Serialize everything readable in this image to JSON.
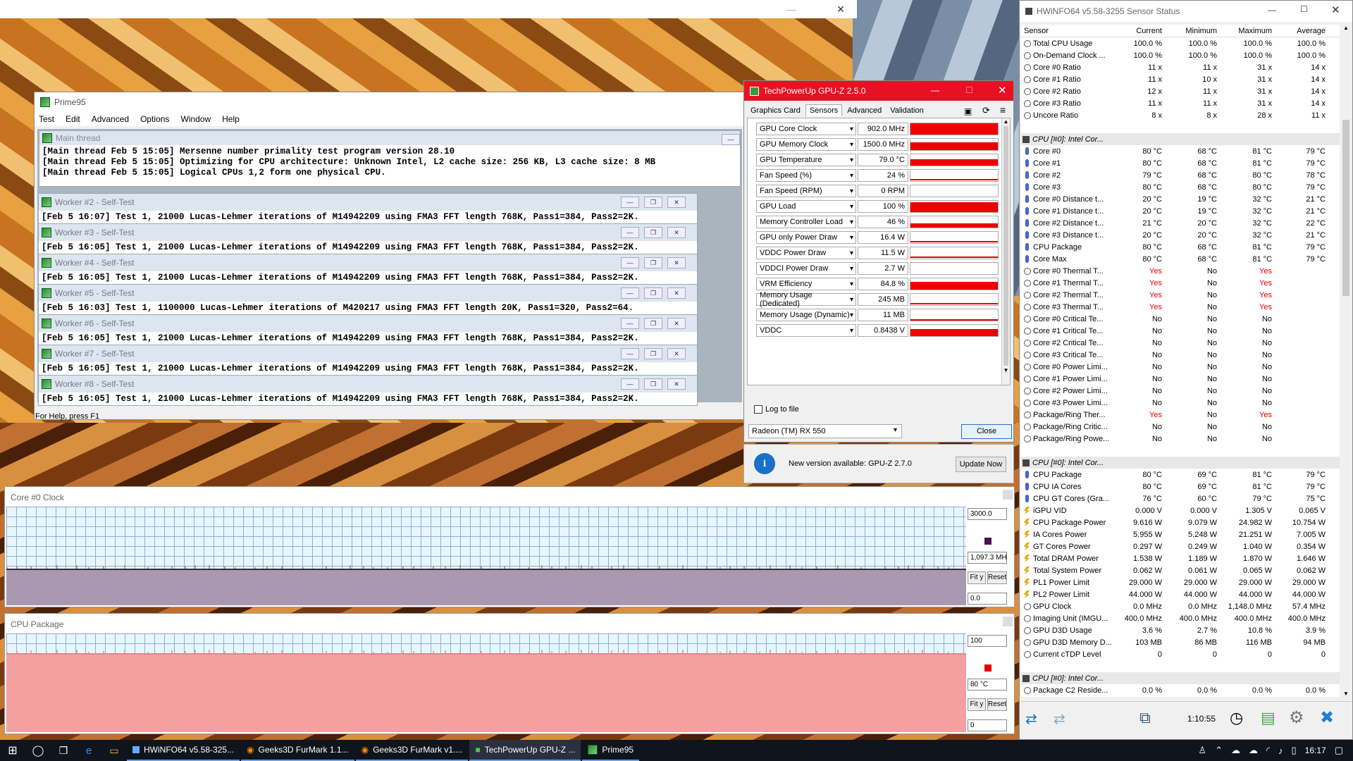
{
  "hwinfo": {
    "title": "HWiNFO64 v5.58-3255 Sensor Status",
    "columns": [
      "Sensor",
      "Current",
      "Minimum",
      "Maximum",
      "Average"
    ],
    "rows": [
      {
        "t": "row",
        "icon": "circle",
        "name": "Total CPU Usage",
        "cur": "100.0 %",
        "min": "100.0 %",
        "max": "100.0 %",
        "avg": "100.0 %"
      },
      {
        "t": "row",
        "icon": "circle",
        "name": "On-Demand Clock ...",
        "cur": "100.0 %",
        "min": "100.0 %",
        "max": "100.0 %",
        "avg": "100.0 %"
      },
      {
        "t": "row",
        "icon": "circle",
        "name": "Core #0 Ratio",
        "cur": "11 x",
        "min": "11 x",
        "max": "31 x",
        "avg": "14 x"
      },
      {
        "t": "row",
        "icon": "circle",
        "name": "Core #1 Ratio",
        "cur": "11 x",
        "min": "10 x",
        "max": "31 x",
        "avg": "14 x"
      },
      {
        "t": "row",
        "icon": "circle",
        "name": "Core #2 Ratio",
        "cur": "12 x",
        "min": "11 x",
        "max": "31 x",
        "avg": "14 x"
      },
      {
        "t": "row",
        "icon": "circle",
        "name": "Core #3 Ratio",
        "cur": "11 x",
        "min": "11 x",
        "max": "31 x",
        "avg": "14 x"
      },
      {
        "t": "row",
        "icon": "circle",
        "name": "Uncore Ratio",
        "cur": "8 x",
        "min": "8 x",
        "max": "28 x",
        "avg": "11 x"
      },
      {
        "t": "blank"
      },
      {
        "t": "group",
        "name": "CPU [#0]: Intel Cor..."
      },
      {
        "t": "row",
        "icon": "therm",
        "name": "Core #0",
        "cur": "80 °C",
        "min": "68 °C",
        "max": "81 °C",
        "avg": "79 °C"
      },
      {
        "t": "row",
        "icon": "therm",
        "name": "Core #1",
        "cur": "80 °C",
        "min": "68 °C",
        "max": "81 °C",
        "avg": "79 °C"
      },
      {
        "t": "row",
        "icon": "therm",
        "name": "Core #2",
        "cur": "79 °C",
        "min": "68 °C",
        "max": "80 °C",
        "avg": "78 °C"
      },
      {
        "t": "row",
        "icon": "therm",
        "name": "Core #3",
        "cur": "80 °C",
        "min": "68 °C",
        "max": "80 °C",
        "avg": "79 °C"
      },
      {
        "t": "row",
        "icon": "therm",
        "name": "Core #0 Distance t...",
        "cur": "20 °C",
        "min": "19 °C",
        "max": "32 °C",
        "avg": "21 °C"
      },
      {
        "t": "row",
        "icon": "therm",
        "name": "Core #1 Distance t...",
        "cur": "20 °C",
        "min": "19 °C",
        "max": "32 °C",
        "avg": "21 °C"
      },
      {
        "t": "row",
        "icon": "therm",
        "name": "Core #2 Distance t...",
        "cur": "21 °C",
        "min": "20 °C",
        "max": "32 °C",
        "avg": "22 °C"
      },
      {
        "t": "row",
        "icon": "therm",
        "name": "Core #3 Distance t...",
        "cur": "20 °C",
        "min": "20 °C",
        "max": "32 °C",
        "avg": "21 °C"
      },
      {
        "t": "row",
        "icon": "therm",
        "name": "CPU Package",
        "cur": "80 °C",
        "min": "68 °C",
        "max": "81 °C",
        "avg": "79 °C"
      },
      {
        "t": "row",
        "icon": "therm",
        "name": "Core Max",
        "cur": "80 °C",
        "min": "68 °C",
        "max": "81 °C",
        "avg": "79 °C"
      },
      {
        "t": "row",
        "icon": "circle",
        "name": "Core #0 Thermal T...",
        "cur": "Yes",
        "min": "No",
        "max": "Yes",
        "avg": "",
        "red": true
      },
      {
        "t": "row",
        "icon": "circle",
        "name": "Core #1 Thermal T...",
        "cur": "Yes",
        "min": "No",
        "max": "Yes",
        "avg": "",
        "red": true
      },
      {
        "t": "row",
        "icon": "circle",
        "name": "Core #2 Thermal T...",
        "cur": "Yes",
        "min": "No",
        "max": "Yes",
        "avg": "",
        "red": true
      },
      {
        "t": "row",
        "icon": "circle",
        "name": "Core #3 Thermal T...",
        "cur": "Yes",
        "min": "No",
        "max": "Yes",
        "avg": "",
        "red": true
      },
      {
        "t": "row",
        "icon": "circle",
        "name": "Core #0 Critical Te...",
        "cur": "No",
        "min": "No",
        "max": "No",
        "avg": ""
      },
      {
        "t": "row",
        "icon": "circle",
        "name": "Core #1 Critical Te...",
        "cur": "No",
        "min": "No",
        "max": "No",
        "avg": ""
      },
      {
        "t": "row",
        "icon": "circle",
        "name": "Core #2 Critical Te...",
        "cur": "No",
        "min": "No",
        "max": "No",
        "avg": ""
      },
      {
        "t": "row",
        "icon": "circle",
        "name": "Core #3 Critical Te...",
        "cur": "No",
        "min": "No",
        "max": "No",
        "avg": ""
      },
      {
        "t": "row",
        "icon": "circle",
        "name": "Core #0 Power Limi...",
        "cur": "No",
        "min": "No",
        "max": "No",
        "avg": ""
      },
      {
        "t": "row",
        "icon": "circle",
        "name": "Core #1 Power Limi...",
        "cur": "No",
        "min": "No",
        "max": "No",
        "avg": ""
      },
      {
        "t": "row",
        "icon": "circle",
        "name": "Core #2 Power Limi...",
        "cur": "No",
        "min": "No",
        "max": "No",
        "avg": ""
      },
      {
        "t": "row",
        "icon": "circle",
        "name": "Core #3 Power Limi...",
        "cur": "No",
        "min": "No",
        "max": "No",
        "avg": ""
      },
      {
        "t": "row",
        "icon": "circle",
        "name": "Package/Ring Ther...",
        "cur": "Yes",
        "min": "No",
        "max": "Yes",
        "avg": "",
        "red": true
      },
      {
        "t": "row",
        "icon": "circle",
        "name": "Package/Ring Critic...",
        "cur": "No",
        "min": "No",
        "max": "No",
        "avg": ""
      },
      {
        "t": "row",
        "icon": "circle",
        "name": "Package/Ring Powe...",
        "cur": "No",
        "min": "No",
        "max": "No",
        "avg": ""
      },
      {
        "t": "blank"
      },
      {
        "t": "group",
        "name": "CPU [#0]: Intel Cor..."
      },
      {
        "t": "row",
        "icon": "therm",
        "name": "CPU Package",
        "cur": "80 °C",
        "min": "69 °C",
        "max": "81 °C",
        "avg": "79 °C"
      },
      {
        "t": "row",
        "icon": "therm",
        "name": "CPU IA Cores",
        "cur": "80 °C",
        "min": "69 °C",
        "max": "81 °C",
        "avg": "79 °C"
      },
      {
        "t": "row",
        "icon": "therm",
        "name": "CPU GT Cores (Gra...",
        "cur": "76 °C",
        "min": "60 °C",
        "max": "79 °C",
        "avg": "75 °C"
      },
      {
        "t": "row",
        "icon": "bolt",
        "name": "iGPU VID",
        "cur": "0.000 V",
        "min": "0.000 V",
        "max": "1.305 V",
        "avg": "0.065 V"
      },
      {
        "t": "row",
        "icon": "bolt",
        "name": "CPU Package Power",
        "cur": "9.616 W",
        "min": "9.079 W",
        "max": "24.982 W",
        "avg": "10.754 W"
      },
      {
        "t": "row",
        "icon": "bolt",
        "name": "IA Cores Power",
        "cur": "5.955 W",
        "min": "5.248 W",
        "max": "21.251 W",
        "avg": "7.005 W"
      },
      {
        "t": "row",
        "icon": "bolt",
        "name": "GT Cores Power",
        "cur": "0.297 W",
        "min": "0.249 W",
        "max": "1.040 W",
        "avg": "0.354 W"
      },
      {
        "t": "row",
        "icon": "bolt",
        "name": "Total DRAM Power",
        "cur": "1.538 W",
        "min": "1.189 W",
        "max": "1.870 W",
        "avg": "1.646 W"
      },
      {
        "t": "row",
        "icon": "bolt",
        "name": "Total System Power",
        "cur": "0.062 W",
        "min": "0.061 W",
        "max": "0.065 W",
        "avg": "0.062 W"
      },
      {
        "t": "row",
        "icon": "bolt",
        "name": "PL1 Power Limit",
        "cur": "29.000 W",
        "min": "29.000 W",
        "max": "29.000 W",
        "avg": "29.000 W"
      },
      {
        "t": "row",
        "icon": "bolt",
        "name": "PL2 Power Limit",
        "cur": "44.000 W",
        "min": "44.000 W",
        "max": "44.000 W",
        "avg": "44.000 W"
      },
      {
        "t": "row",
        "icon": "circle",
        "name": "GPU Clock",
        "cur": "0.0 MHz",
        "min": "0.0 MHz",
        "max": "1,148.0 MHz",
        "avg": "57.4 MHz"
      },
      {
        "t": "row",
        "icon": "circle",
        "name": "Imaging Unit (IMGU...",
        "cur": "400.0 MHz",
        "min": "400.0 MHz",
        "max": "400.0 MHz",
        "avg": "400.0 MHz"
      },
      {
        "t": "row",
        "icon": "circle",
        "name": "GPU D3D Usage",
        "cur": "3.6 %",
        "min": "2.7 %",
        "max": "10.8 %",
        "avg": "3.9 %"
      },
      {
        "t": "row",
        "icon": "circle",
        "name": "GPU D3D Memory D...",
        "cur": "103 MB",
        "min": "86 MB",
        "max": "116 MB",
        "avg": "94 MB"
      },
      {
        "t": "row",
        "icon": "circle",
        "name": "Current cTDP Level",
        "cur": "0",
        "min": "0",
        "max": "0",
        "avg": "0"
      },
      {
        "t": "blank"
      },
      {
        "t": "group",
        "name": "CPU [#0]: Intel Cor..."
      },
      {
        "t": "row",
        "icon": "circle",
        "name": "Package C2 Reside...",
        "cur": "0.0 %",
        "min": "0.0 %",
        "max": "0.0 %",
        "avg": "0.0 %"
      }
    ],
    "elapsed": "1:10:55"
  },
  "gpuz": {
    "title": "TechPowerUp GPU-Z 2.5.0",
    "tabs": [
      "Graphics Card",
      "Sensors",
      "Advanced",
      "Validation"
    ],
    "sensors": [
      {
        "label": "GPU Core Clock",
        "value": "902.0 MHz",
        "fill": 1.0
      },
      {
        "label": "GPU Memory Clock",
        "value": "1500.0 MHz",
        "fill": 0.7
      },
      {
        "label": "GPU Temperature",
        "value": "79.0 °C",
        "fill": 0.55
      },
      {
        "label": "Fan Speed (%)",
        "value": "24 %",
        "fill": 0.1
      },
      {
        "label": "Fan Speed (RPM)",
        "value": "0 RPM",
        "fill": 0.0
      },
      {
        "label": "GPU Load",
        "value": "100 %",
        "fill": 0.85
      },
      {
        "label": "Memory Controller Load",
        "value": "46 %",
        "fill": 0.4
      },
      {
        "label": "GPU only Power Draw",
        "value": "16.4 W",
        "fill": 0.05
      },
      {
        "label": "VDDC Power Draw",
        "value": "11.5 W",
        "fill": 0.04
      },
      {
        "label": "VDDCI Power Draw",
        "value": "2.7 W",
        "fill": 0.0
      },
      {
        "label": "VRM Efficiency",
        "value": "84.8 %",
        "fill": 0.7
      },
      {
        "label": "Memory Usage (Dedicated)",
        "value": "245 MB",
        "fill": 0.05
      },
      {
        "label": "Memory Usage (Dynamic)",
        "value": "11 MB",
        "fill": 0.02
      },
      {
        "label": "VDDC",
        "value": "0.8438 V",
        "fill": 0.65
      }
    ],
    "log_label": "Log to file",
    "device": "Radeon (TM) RX 550",
    "close_label": "Close",
    "update_msg": "New version available: GPU-Z 2.7.0",
    "update_btn": "Update Now"
  },
  "prime95": {
    "title": "Prime95",
    "menu": [
      "Test",
      "Edit",
      "Advanced",
      "Options",
      "Window",
      "Help"
    ],
    "main_title": "Main thread",
    "main_lines": [
      "[Main thread Feb 5 15:05] Mersenne number primality test program version 28.10",
      "[Main thread Feb 5 15:05] Optimizing for CPU architecture: Unknown Intel, L2 cache size: 256 KB, L3 cache size: 8 MB",
      "[Main thread Feb 5 15:05] Logical CPUs 1,2 form one physical CPU."
    ],
    "workers": [
      {
        "title": "Worker #2 - Self-Test",
        "line": "[Feb 5 16:07] Test 1, 21000 Lucas-Lehmer iterations of M14942209 using FMA3 FFT length 768K, Pass1=384, Pass2=2K."
      },
      {
        "title": "Worker #3 - Self-Test",
        "line": "[Feb 5 16:05] Test 1, 21000 Lucas-Lehmer iterations of M14942209 using FMA3 FFT length 768K, Pass1=384, Pass2=2K."
      },
      {
        "title": "Worker #4 - Self-Test",
        "line": "[Feb 5 16:05] Test 1, 21000 Lucas-Lehmer iterations of M14942209 using FMA3 FFT length 768K, Pass1=384, Pass2=2K."
      },
      {
        "title": "Worker #5 - Self-Test",
        "line": "[Feb 5 16:03] Test 1, 1100000 Lucas-Lehmer iterations of M420217 using FMA3 FFT length 20K, Pass1=320, Pass2=64."
      },
      {
        "title": "Worker #6 - Self-Test",
        "line": "[Feb 5 16:05] Test 1, 21000 Lucas-Lehmer iterations of M14942209 using FMA3 FFT length 768K, Pass1=384, Pass2=2K."
      },
      {
        "title": "Worker #7 - Self-Test",
        "line": "[Feb 5 16:05] Test 1, 21000 Lucas-Lehmer iterations of M14942209 using FMA3 FFT length 768K, Pass1=384, Pass2=2K."
      },
      {
        "title": "Worker #8 - Self-Test",
        "line": "[Feb 5 16:05] Test 1, 21000 Lucas-Lehmer iterations of M14942209 using FMA3 FFT length 768K, Pass1=384, Pass2=2K."
      }
    ],
    "status": "For Help, press F1"
  },
  "graphs": [
    {
      "title": "Core #0 Clock",
      "top": "3000.0",
      "current": "1,097.3 MH:",
      "bottom": "0.0",
      "fity": "Fit y",
      "reset": "Reset",
      "fill_color": "#a898b0",
      "marker_color": "#4a1050",
      "level": 0.37
    },
    {
      "title": "CPU Package",
      "top": "100",
      "current": "80 °C",
      "bottom": "0",
      "fity": "Fit y",
      "reset": "Reset",
      "fill_color": "#f4a0a0",
      "marker_color": "#e00000",
      "level": 0.8
    }
  ],
  "taskbar": {
    "items": [
      "HWiNFO64 v5.58-325...",
      "Geeks3D FurMark 1.1...",
      "Geeks3D FurMark v1....",
      "TechPowerUp GPU-Z ...",
      "Prime95"
    ],
    "time": "16:17"
  }
}
